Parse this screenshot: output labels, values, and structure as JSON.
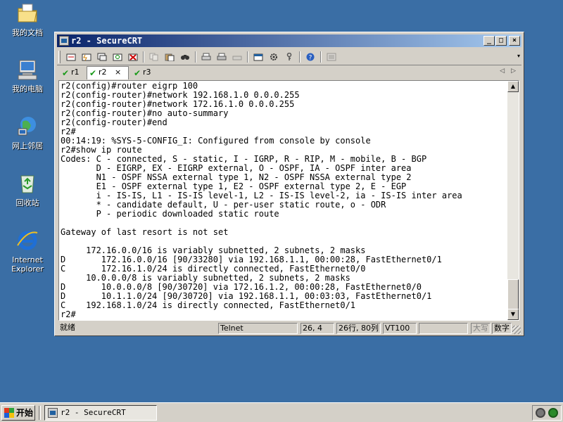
{
  "desktop": {
    "icons": [
      {
        "label": "我的文档",
        "icon": "my-documents-icon"
      },
      {
        "label": "我的电脑",
        "icon": "my-computer-icon"
      },
      {
        "label": "网上邻居",
        "icon": "network-places-icon"
      },
      {
        "label": "回收站",
        "icon": "recycle-bin-icon"
      },
      {
        "label": "Internet Explorer",
        "icon": "internet-explorer-icon"
      }
    ]
  },
  "window": {
    "title": "r2 - SecureCRT",
    "caption_buttons": {
      "minimize": "_",
      "maximize": "□",
      "close": "×"
    }
  },
  "tabs": [
    {
      "label": "r1",
      "active": false
    },
    {
      "label": "r2",
      "active": true,
      "close": "×"
    },
    {
      "label": "r3",
      "active": false
    }
  ],
  "tab_scroll": {
    "left": "◁",
    "right": "▷"
  },
  "terminal": {
    "lines": [
      "r2(config)#router eigrp 100",
      "r2(config-router)#network 192.168.1.0 0.0.0.255",
      "r2(config-router)#network 172.16.1.0 0.0.0.255",
      "r2(config-router)#no auto-summary",
      "r2(config-router)#end",
      "r2#",
      "00:14:19: %SYS-5-CONFIG_I: Configured from console by console",
      "r2#show ip route",
      "Codes: C - connected, S - static, I - IGRP, R - RIP, M - mobile, B - BGP",
      "       D - EIGRP, EX - EIGRP external, O - OSPF, IA - OSPF inter area",
      "       N1 - OSPF NSSA external type 1, N2 - OSPF NSSA external type 2",
      "       E1 - OSPF external type 1, E2 - OSPF external type 2, E - EGP",
      "       i - IS-IS, L1 - IS-IS level-1, L2 - IS-IS level-2, ia - IS-IS inter area",
      "       * - candidate default, U - per-user static route, o - ODR",
      "       P - periodic downloaded static route",
      "",
      "Gateway of last resort is not set",
      "",
      "     172.16.0.0/16 is variably subnetted, 2 subnets, 2 masks",
      "D       172.16.0.0/16 [90/33280] via 192.168.1.1, 00:00:28, FastEthernet0/1",
      "C       172.16.1.0/24 is directly connected, FastEthernet0/0",
      "     10.0.0.0/8 is variably subnetted, 2 subnets, 2 masks",
      "D       10.0.0.0/8 [90/30720] via 172.16.1.2, 00:00:28, FastEthernet0/0",
      "D       10.1.1.0/24 [90/30720] via 192.168.1.1, 00:03:03, FastEthernet0/1",
      "C    192.168.1.0/24 is directly connected, FastEthernet0/1",
      "r2#"
    ],
    "scroll_up": "▲",
    "scroll_down": "▼"
  },
  "statusbar": {
    "ready": "就绪",
    "protocol": "Telnet",
    "cursor": "26, 4",
    "size": "26行, 80列",
    "emulation": "VT100",
    "caps": "大写",
    "num": "数字"
  },
  "taskbar": {
    "start_label": "开始",
    "task_label": "r2 - SecureCRT"
  },
  "colors": {
    "desktop": "#3a6ea5",
    "titlebar_start": "#0a246a",
    "titlebar_end": "#a6caf0",
    "chrome": "#d4d0c8",
    "tab_check": "#1a9a1a"
  }
}
